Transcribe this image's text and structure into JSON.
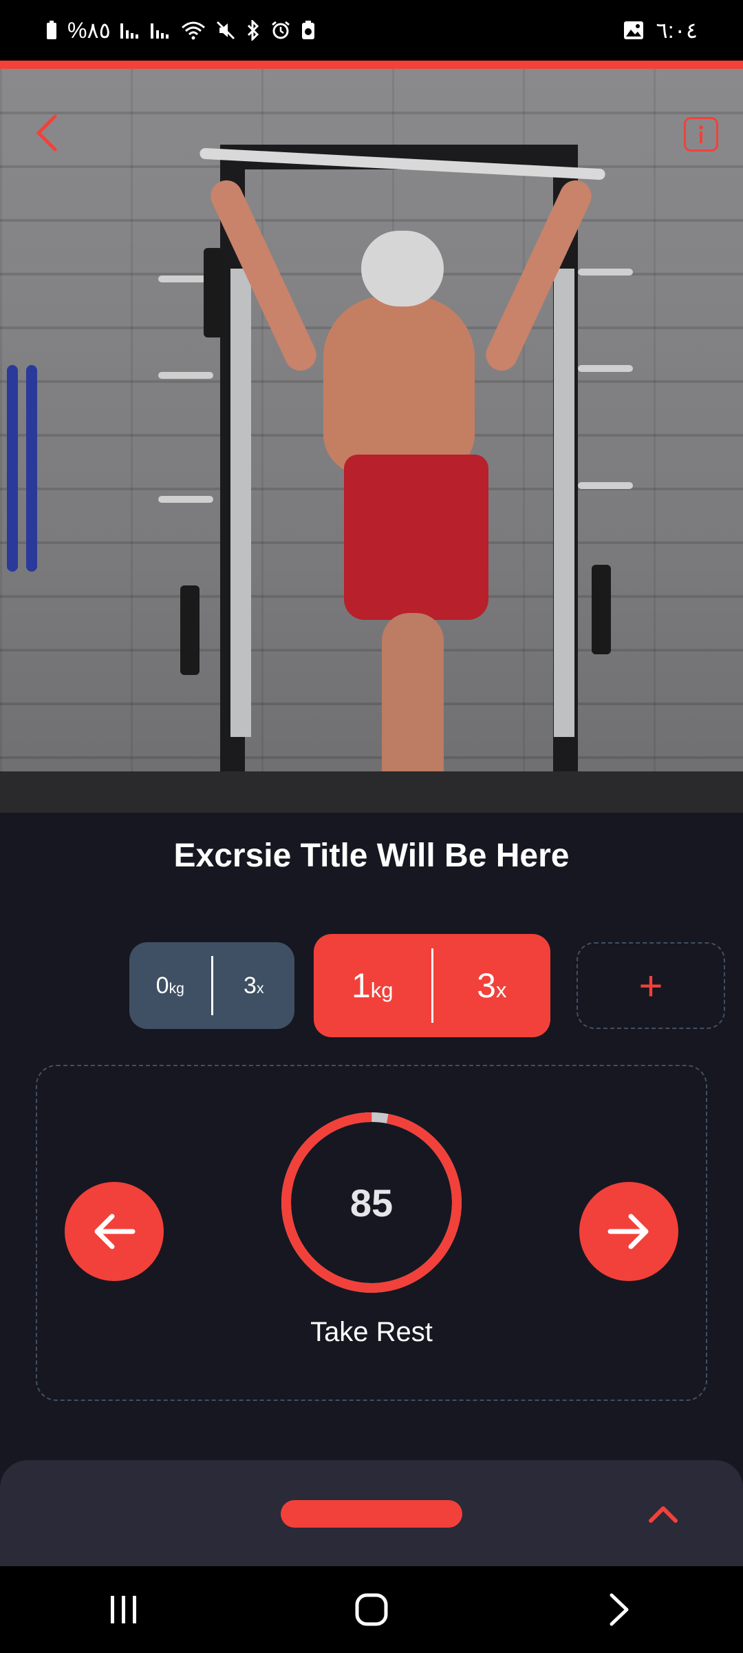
{
  "status_bar": {
    "battery_text": "%٨٥",
    "time": "٦:٠٤",
    "left_icons": [
      "battery-icon",
      "signal-icon",
      "signal-icon",
      "wifi-icon",
      "mute-icon",
      "bluetooth-icon",
      "alarm-icon",
      "battery-saver-icon"
    ],
    "right_icons": [
      "gallery-notification-icon"
    ]
  },
  "header": {
    "back_icon": "chevron-left-icon",
    "info_icon": "info-icon"
  },
  "exercise": {
    "title": "Excrsie Title Will Be Here",
    "media": "pull-up exercise photo"
  },
  "sets": {
    "previous": {
      "weight": "0",
      "weight_unit": "kg",
      "reps": "3",
      "reps_unit": "x"
    },
    "current": {
      "weight": "1",
      "weight_unit": "kg",
      "reps": "3",
      "reps_unit": "x"
    },
    "add_label": "+"
  },
  "rest": {
    "timer_value": "85",
    "label": "Take Rest",
    "progress_fraction": 0.97
  },
  "bottom_sheet": {
    "chevron_icon": "chevron-up-icon"
  },
  "colors": {
    "accent": "#f2413a",
    "background": "#171721",
    "set_inactive": "#3f5064",
    "sheet": "#2a2a38"
  }
}
